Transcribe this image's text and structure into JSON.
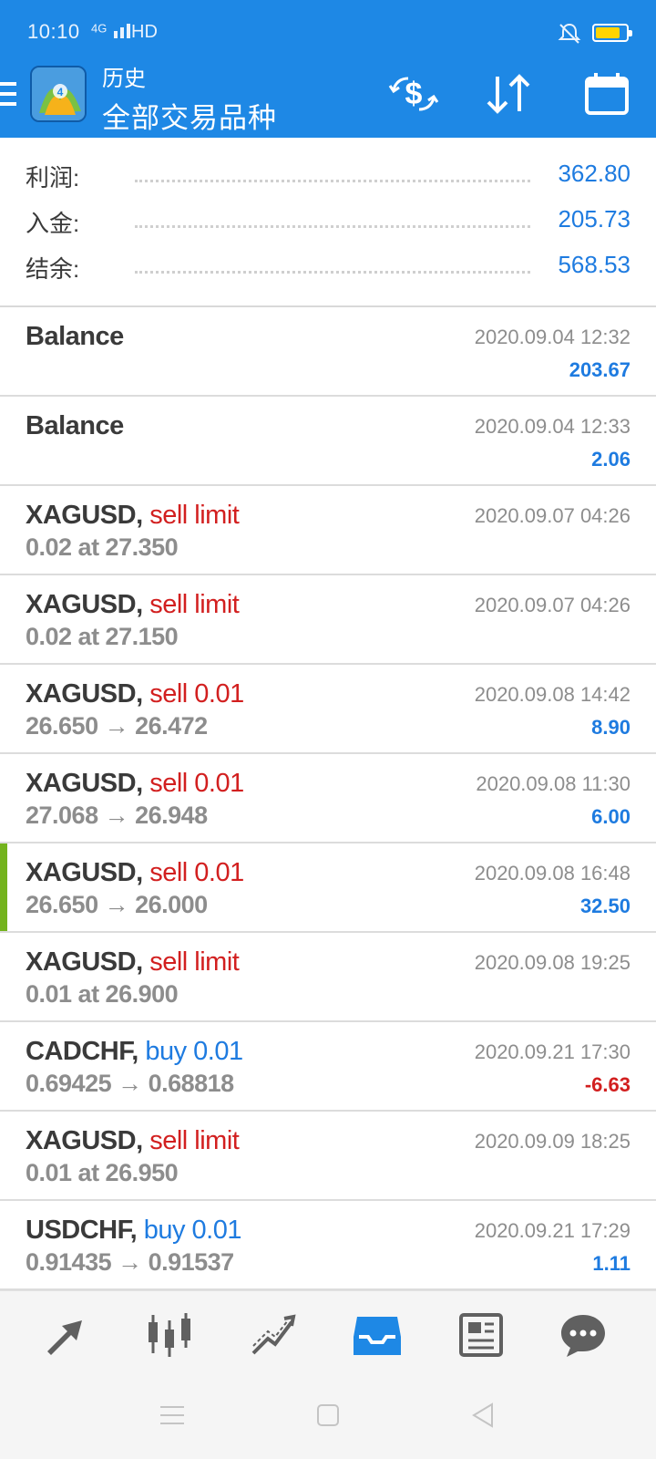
{
  "status_bar": {
    "time": "10:10",
    "signal": "4G",
    "hd": "HD",
    "battery_color": "#ffd400"
  },
  "app_bar": {
    "title_small": "历史",
    "title_big": "全部交易品种",
    "icons": [
      "menu-icon",
      "metatrader-logo",
      "currency-exchange-icon",
      "sort-icon",
      "calendar-icon"
    ]
  },
  "summary": [
    {
      "label": "利润:",
      "value": "362.80"
    },
    {
      "label": "入金:",
      "value": "205.73"
    },
    {
      "label": "结余:",
      "value": "568.53"
    }
  ],
  "deals": [
    {
      "symbol": "Balance",
      "action": "",
      "action_type": "",
      "detail": "",
      "date": "2020.09.04 12:32",
      "profit": "203.67",
      "profit_sign": "pos"
    },
    {
      "symbol": "Balance",
      "action": "",
      "action_type": "",
      "detail": "",
      "date": "2020.09.04 12:33",
      "profit": "2.06",
      "profit_sign": "pos"
    },
    {
      "symbol": "XAGUSD,",
      "action": "sell limit",
      "action_type": "sell",
      "detail": "0.02 at 27.350",
      "date": "2020.09.07 04:26",
      "profit": "",
      "profit_sign": ""
    },
    {
      "symbol": "XAGUSD,",
      "action": "sell limit",
      "action_type": "sell",
      "detail": "0.02 at 27.150",
      "date": "2020.09.07 04:26",
      "profit": "",
      "profit_sign": ""
    },
    {
      "symbol": "XAGUSD,",
      "action": "sell 0.01",
      "action_type": "sell",
      "detail": "26.650 → 26.472",
      "date": "2020.09.08 14:42",
      "profit": "8.90",
      "profit_sign": "pos"
    },
    {
      "symbol": "XAGUSD,",
      "action": "sell 0.01",
      "action_type": "sell",
      "detail": "27.068 → 26.948",
      "date": "2020.09.08 11:30",
      "profit": "6.00",
      "profit_sign": "pos"
    },
    {
      "symbol": "XAGUSD,",
      "action": "sell 0.01",
      "action_type": "sell",
      "detail": "26.650 → 26.000",
      "date": "2020.09.08 16:48",
      "profit": "32.50",
      "profit_sign": "pos",
      "selected": true
    },
    {
      "symbol": "XAGUSD,",
      "action": "sell limit",
      "action_type": "sell",
      "detail": "0.01 at 26.900",
      "date": "2020.09.08 19:25",
      "profit": "",
      "profit_sign": ""
    },
    {
      "symbol": "CADCHF,",
      "action": "buy 0.01",
      "action_type": "buy",
      "detail": "0.69425 → 0.68818",
      "date": "2020.09.21 17:30",
      "profit": "-6.63",
      "profit_sign": "neg"
    },
    {
      "symbol": "XAGUSD,",
      "action": "sell limit",
      "action_type": "sell",
      "detail": "0.01 at 26.950",
      "date": "2020.09.09 18:25",
      "profit": "",
      "profit_sign": ""
    },
    {
      "symbol": "USDCHF,",
      "action": "buy 0.01",
      "action_type": "buy",
      "detail": "0.91435 → 0.91537",
      "date": "2020.09.21 17:29",
      "profit": "1.11",
      "profit_sign": "pos"
    }
  ],
  "bottom_nav": {
    "items": [
      "quotes-icon",
      "chart-icon",
      "trade-icon",
      "history-icon",
      "news-icon",
      "chat-icon"
    ],
    "active_color": "#1e88e5",
    "inactive_color": "#606060"
  },
  "colors": {
    "primary": "#1e88e5",
    "sell": "#d21f1f",
    "buy": "#1e7be0",
    "selected_marker": "#73b31d"
  }
}
